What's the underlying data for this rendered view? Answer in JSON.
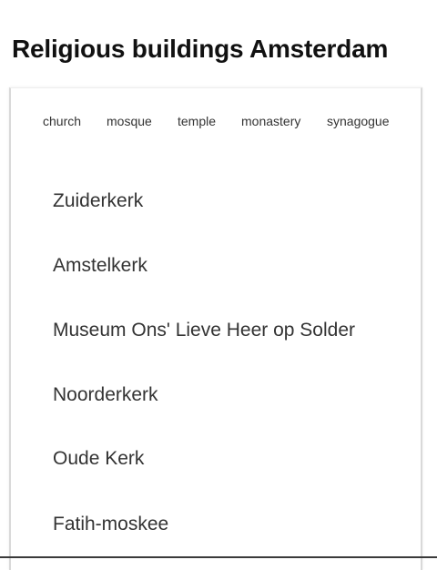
{
  "header": {
    "title": "Religious buildings Amsterdam"
  },
  "filters": [
    {
      "label": "church"
    },
    {
      "label": "mosque"
    },
    {
      "label": "temple"
    },
    {
      "label": "monastery"
    },
    {
      "label": "synagogue"
    }
  ],
  "buildings": [
    {
      "name": "Zuiderkerk"
    },
    {
      "name": "Amstelkerk"
    },
    {
      "name": "Museum Ons' Lieve Heer op Solder"
    },
    {
      "name": "Noorderkerk"
    },
    {
      "name": "Oude Kerk"
    },
    {
      "name": "Fatih-moskee"
    }
  ]
}
